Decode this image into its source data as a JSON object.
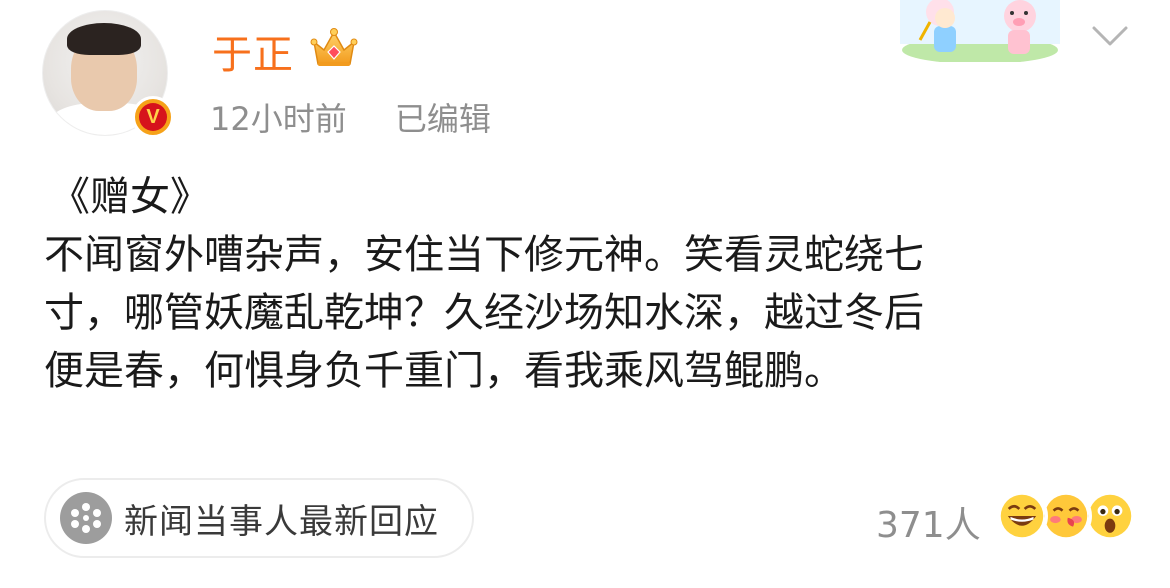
{
  "author": {
    "name": "于正",
    "verified_badge": "V",
    "crown_icon": "crown-icon"
  },
  "meta": {
    "time": "12小时前",
    "edited": "已编辑"
  },
  "content": {
    "title": "《赠女》",
    "lines": [
      "不闻窗外嘈杂声，安住当下修元神。笑看灵蛇绕七",
      "寸，哪管妖魔乱乾坤？久经沙场知水深，越过冬后",
      "便是春，何惧身负千重门，看我乘风驾鲲鹏。"
    ]
  },
  "topic": {
    "label": "新闻当事人最新回应",
    "icon": "sparkle-icon"
  },
  "reactions": {
    "count": "371人",
    "emojis": [
      "laughing-emoji-icon",
      "cheek-kiss-emoji-icon",
      "surprised-emoji-icon"
    ]
  },
  "colors": {
    "name": "#f7701c",
    "meta": "#8e8e8e",
    "text": "#1a1a1a",
    "badge_red": "#d6131c",
    "badge_gold": "#f6a219"
  }
}
